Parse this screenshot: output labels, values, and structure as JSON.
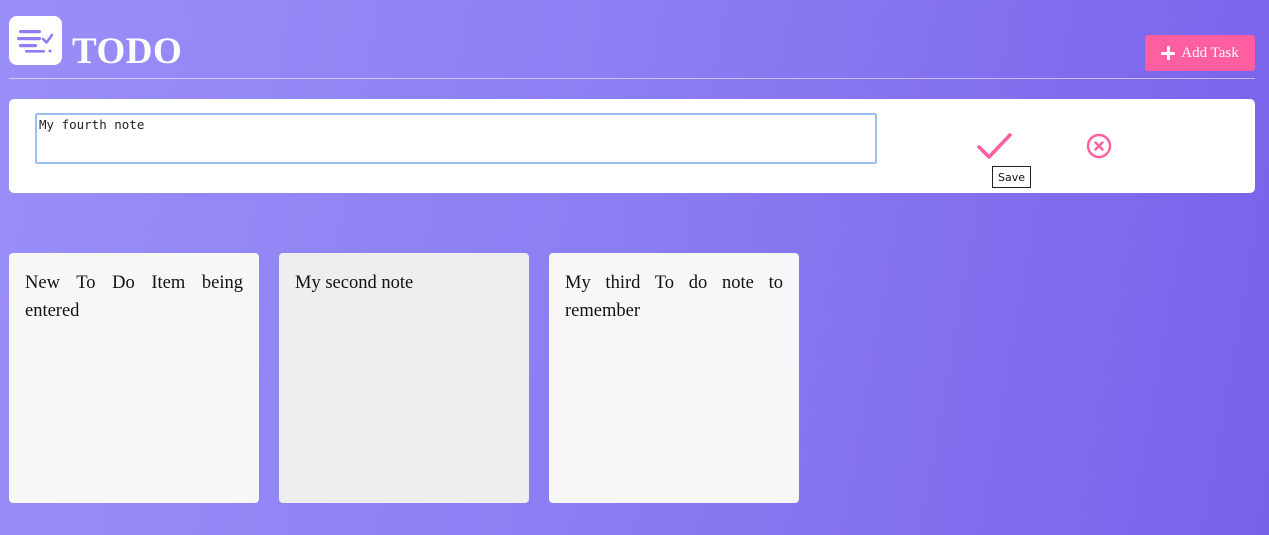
{
  "header": {
    "title": "TODO",
    "logo_icon": "checklist-icon",
    "add_task_label": "Add Task",
    "add_task_icon": "plus-icon"
  },
  "editor": {
    "input_value": "My fourth note",
    "save_icon": "checkmark-icon",
    "cancel_icon": "close-circle-icon",
    "save_tooltip": "Save"
  },
  "notes": [
    {
      "text": "New To Do Item being entered"
    },
    {
      "text": "My second note"
    },
    {
      "text": "My third To do note to remember"
    }
  ],
  "colors": {
    "accent": "#ff5fa0",
    "background_start": "#9a8ef8",
    "background_end": "#7862ea",
    "logo_icon": "#8c7ff3"
  }
}
